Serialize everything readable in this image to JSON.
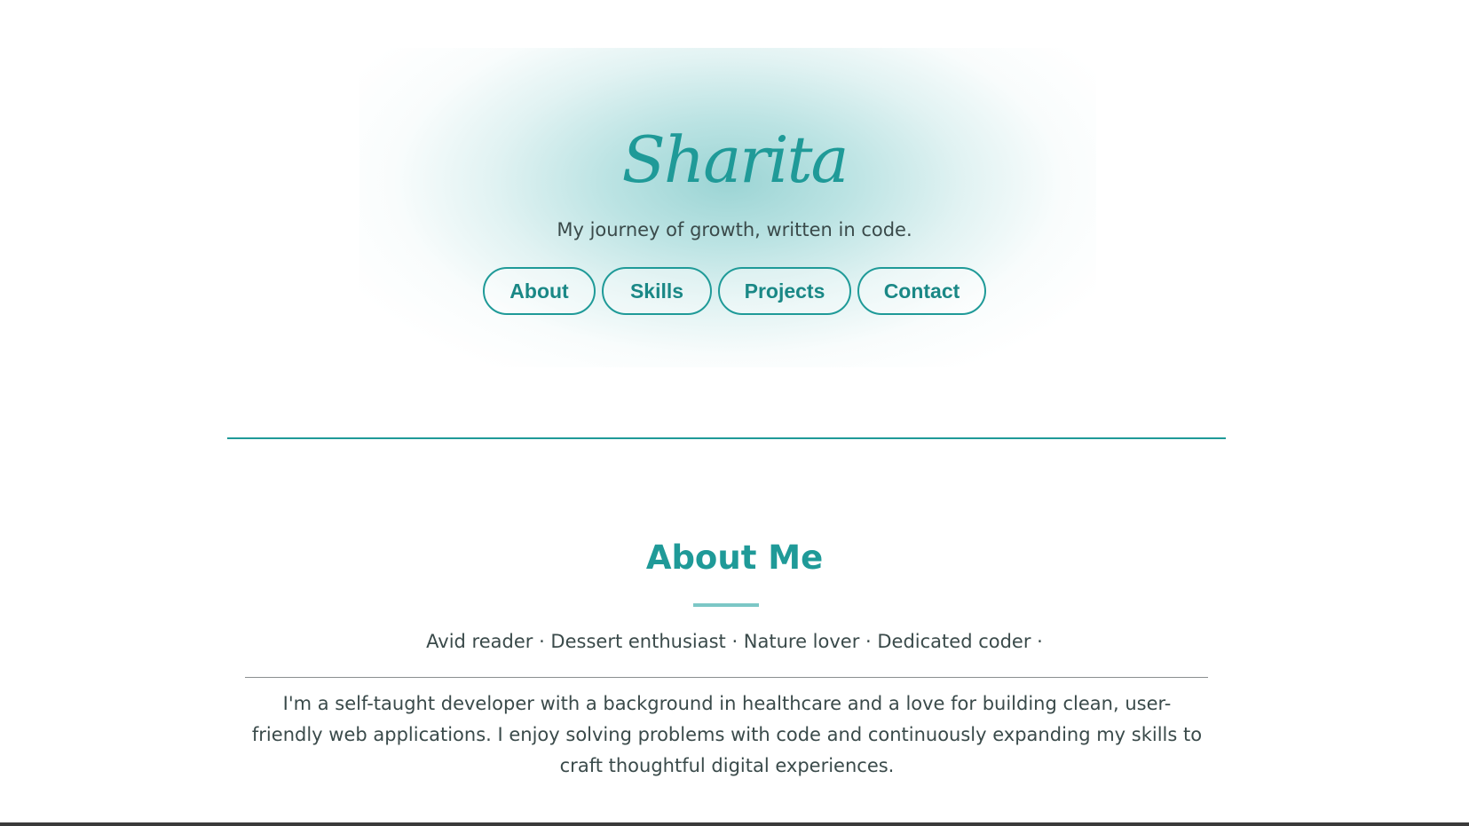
{
  "colors": {
    "accent": "#1f9a98",
    "accent_light": "#7cc7c6",
    "text": "#3a4a4a",
    "hero_glow": "#a8dad9"
  },
  "header": {
    "brand": "Sharita",
    "tagline": "My journey of growth, written in code."
  },
  "nav": {
    "items": [
      {
        "label": "About"
      },
      {
        "label": "Skills"
      },
      {
        "label": "Projects"
      },
      {
        "label": "Contact"
      }
    ]
  },
  "about": {
    "title": "About Me",
    "traits": "Avid reader · Dessert enthusiast · Nature lover · Dedicated coder ·",
    "bio": "I'm a self-taught developer with a background in healthcare and a love for building clean, user-friendly web applications. I enjoy solving problems with code and continuously expanding my skills to craft thoughtful digital experiences."
  }
}
